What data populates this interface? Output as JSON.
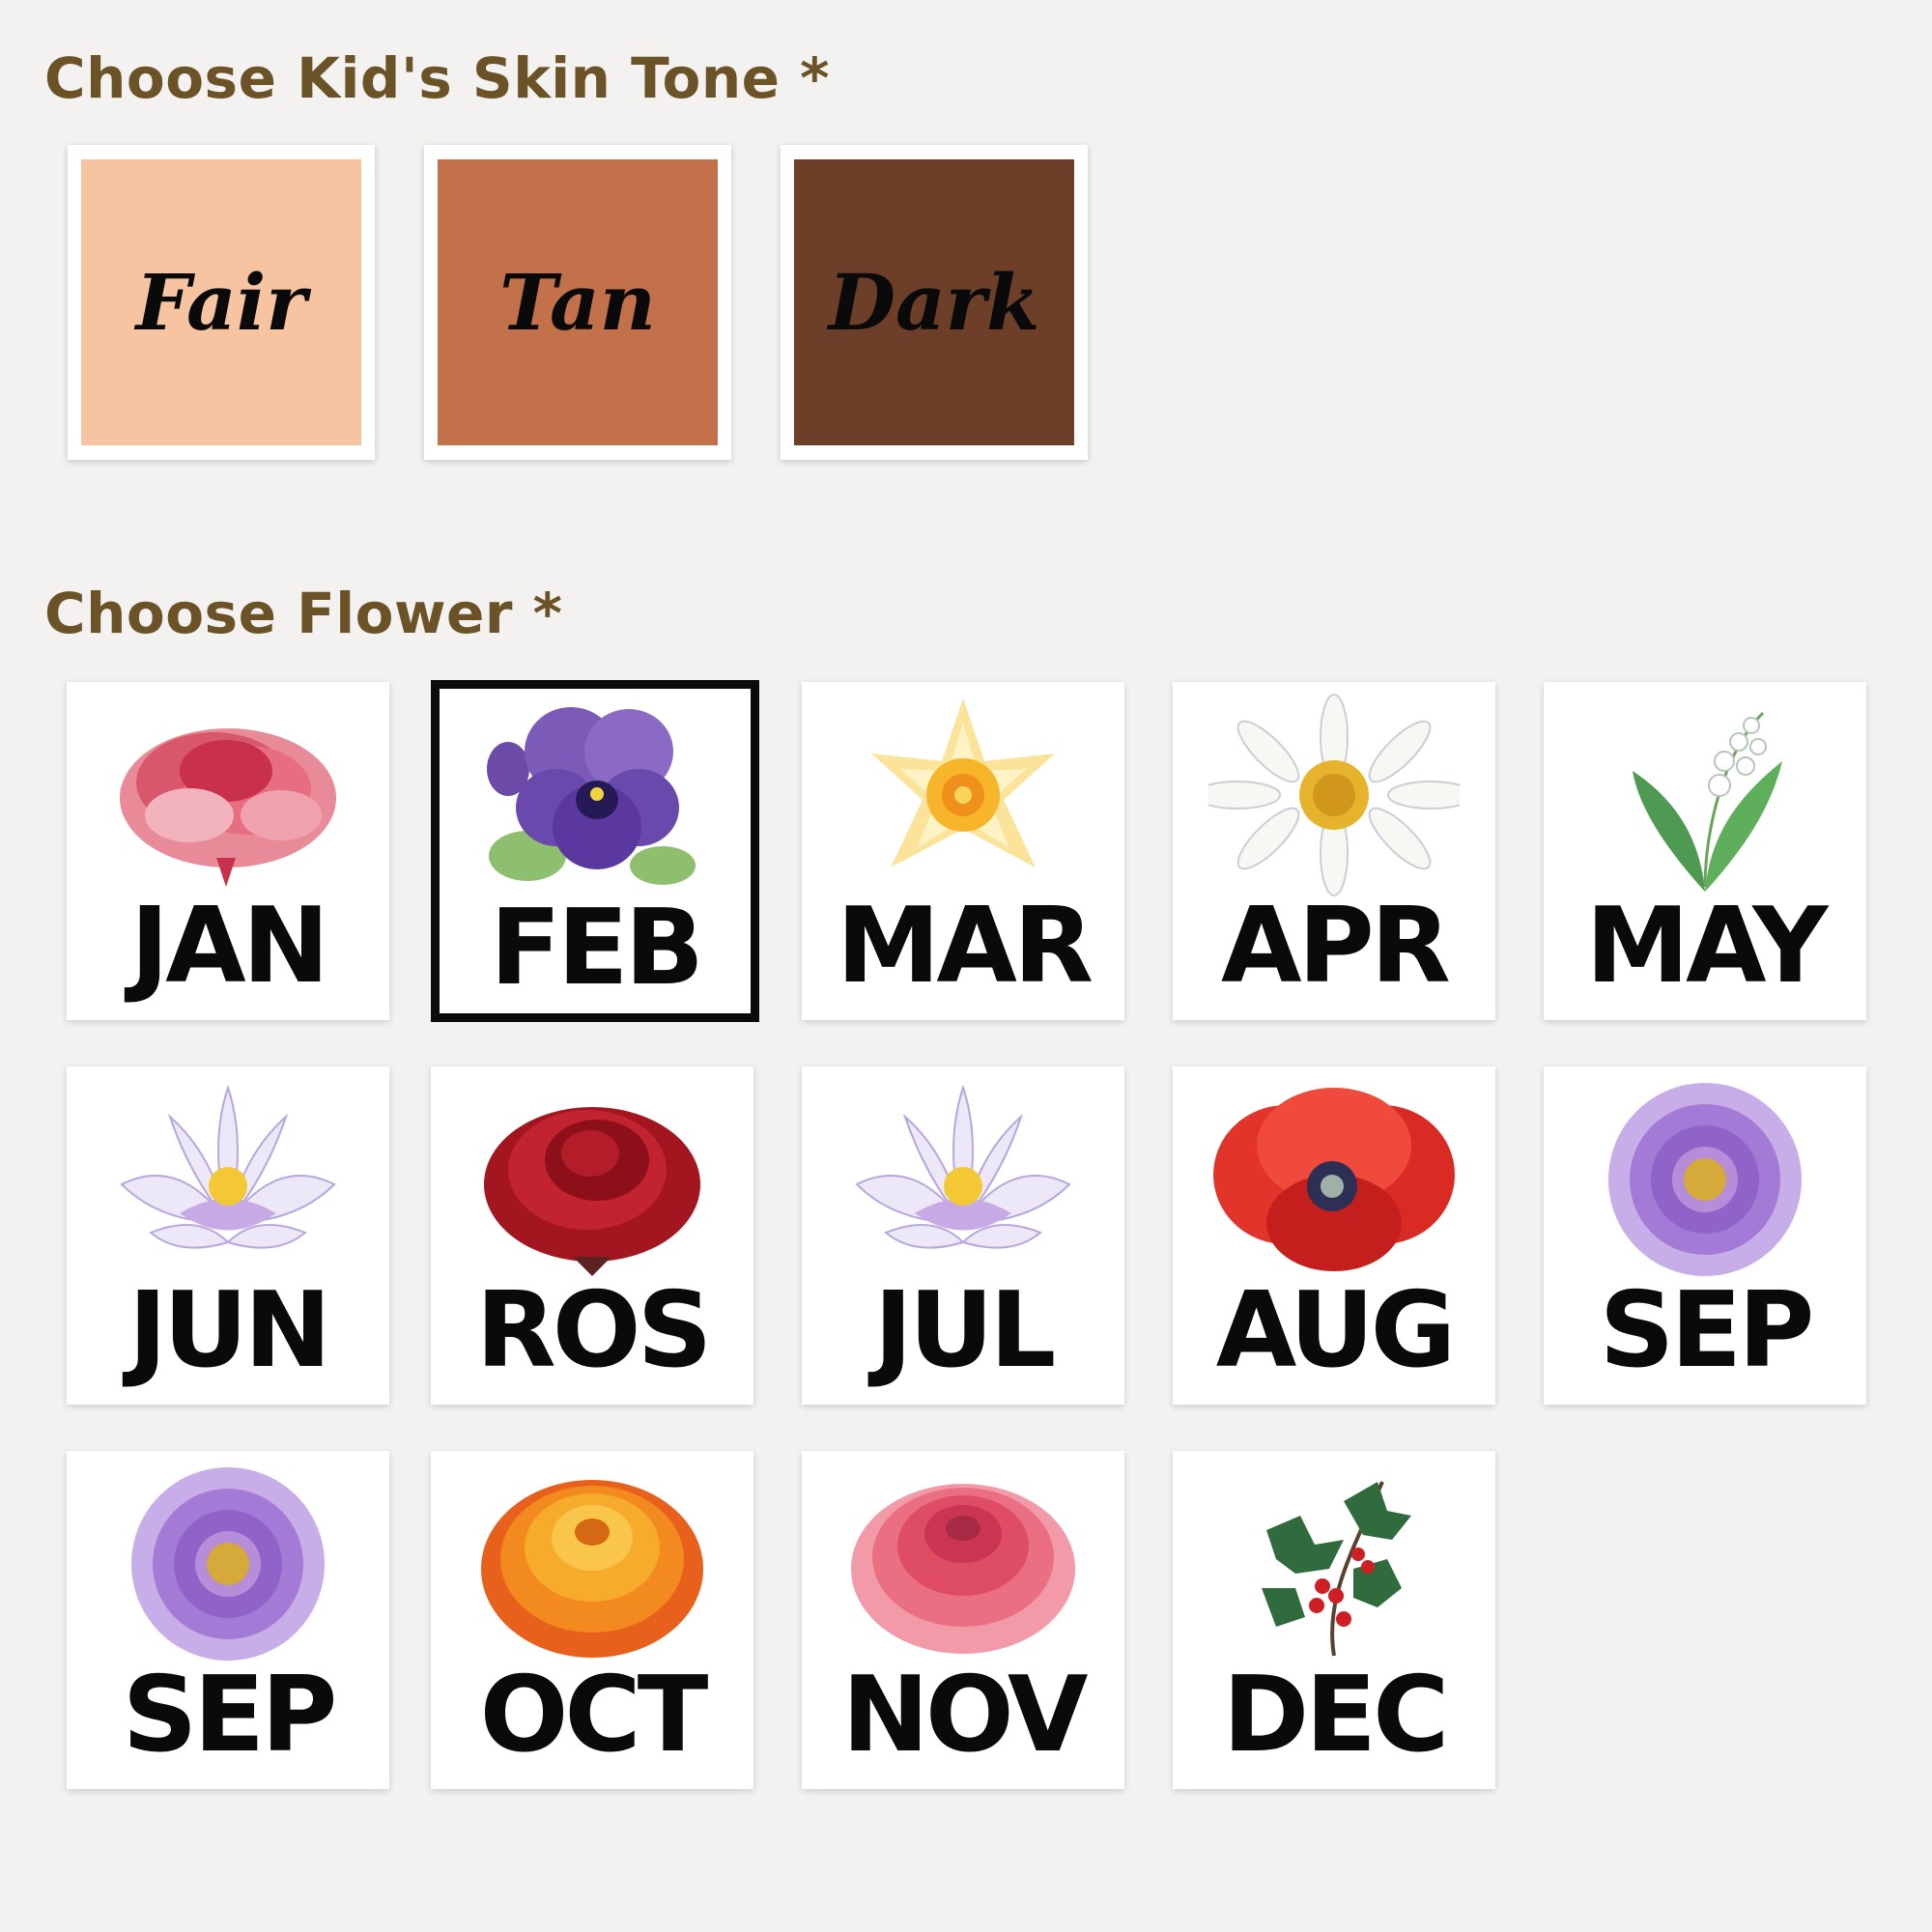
{
  "skin_tone": {
    "heading": "Choose Kid's Skin Tone *",
    "options": [
      {
        "label": "Fair",
        "color": "#f6c4a0"
      },
      {
        "label": "Tan",
        "color": "#c2714a"
      },
      {
        "label": "Dark",
        "color": "#6d3f28"
      }
    ]
  },
  "flower": {
    "heading": "Choose Flower *",
    "selected_label": "FEB",
    "options": [
      {
        "label": "JAN",
        "icon": "carnation-icon"
      },
      {
        "label": "FEB",
        "icon": "violet-icon"
      },
      {
        "label": "MAR",
        "icon": "daffodil-icon"
      },
      {
        "label": "APR",
        "icon": "daisy-icon"
      },
      {
        "label": "MAY",
        "icon": "lily-of-the-valley-icon"
      },
      {
        "label": "JUN",
        "icon": "water-lily-icon"
      },
      {
        "label": "ROS",
        "icon": "rose-icon"
      },
      {
        "label": "JUL",
        "icon": "water-lily-icon"
      },
      {
        "label": "AUG",
        "icon": "poppy-icon"
      },
      {
        "label": "SEP",
        "icon": "aster-icon"
      },
      {
        "label": "SEP",
        "icon": "aster-icon"
      },
      {
        "label": "OCT",
        "icon": "marigold-icon"
      },
      {
        "label": "NOV",
        "icon": "chrysanthemum-icon"
      },
      {
        "label": "DEC",
        "icon": "holly-icon"
      }
    ]
  }
}
